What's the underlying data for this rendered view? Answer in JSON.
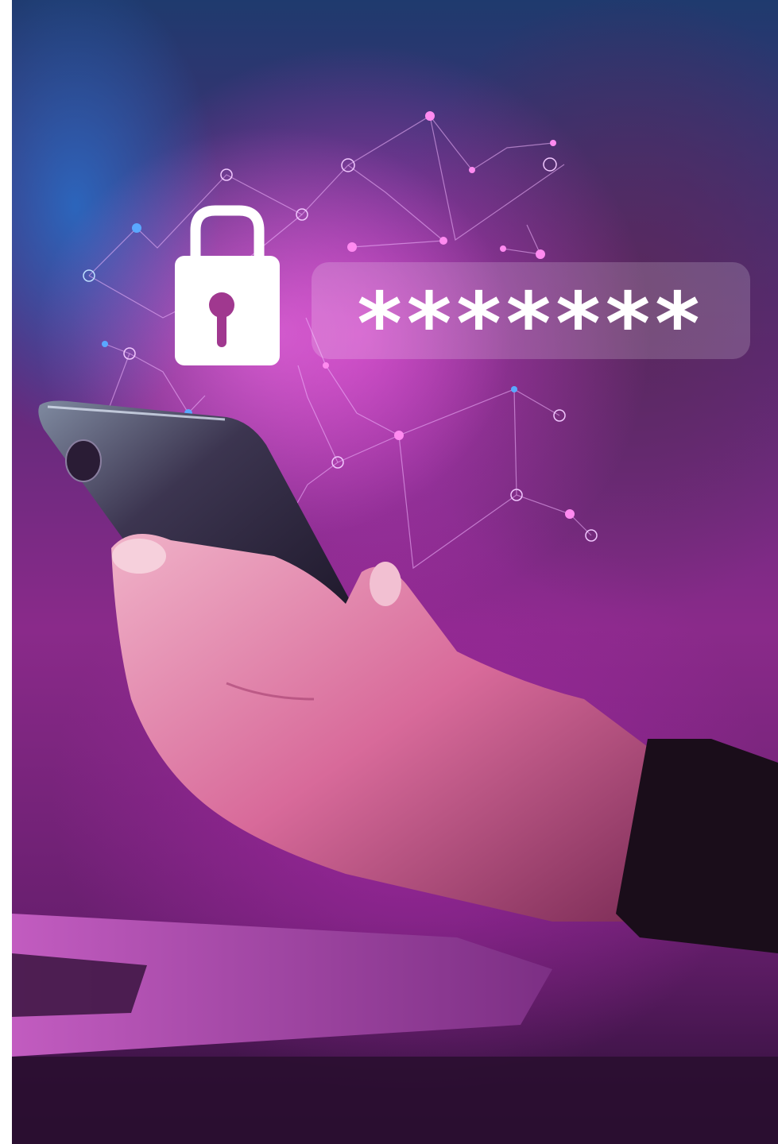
{
  "scene": {
    "description_icon": "padlock-icon",
    "masked_password": "*******"
  },
  "colors": {
    "accent_magenta": "#d63cc8",
    "accent_blue": "#2f78d0",
    "icon_white": "#ffffff"
  }
}
